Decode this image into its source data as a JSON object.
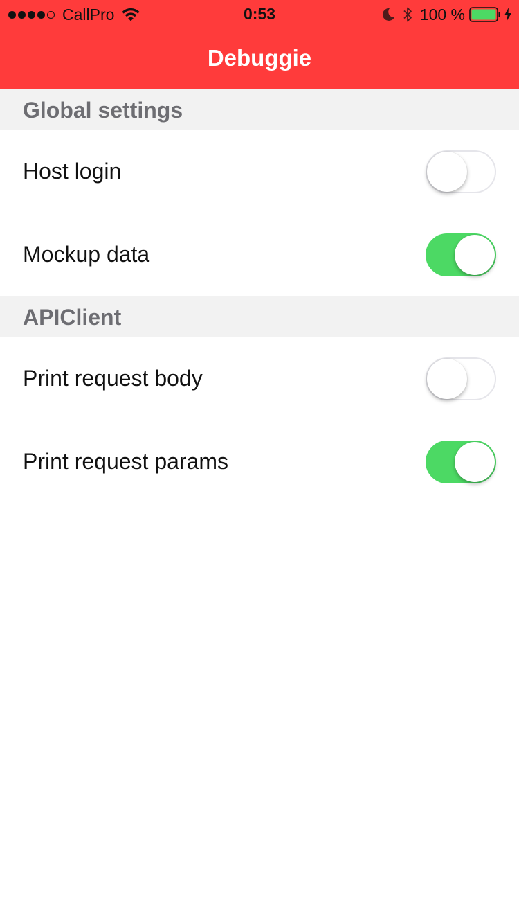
{
  "status_bar": {
    "carrier": "CallPro",
    "time": "0:53",
    "battery_percent": "100 %",
    "signal_bars_filled": 4,
    "signal_bars_total": 5,
    "icons": [
      "wifi-icon",
      "moon-icon",
      "bluetooth-icon",
      "battery-icon",
      "charging-icon"
    ]
  },
  "nav": {
    "title": "Debuggie"
  },
  "colors": {
    "nav_background": "#FF3B3B",
    "switch_on": "#4CD964",
    "section_background": "#F2F2F2",
    "section_text": "#6D6D72"
  },
  "sections": [
    {
      "title": "Global settings",
      "rows": [
        {
          "label": "Host login",
          "on": false
        },
        {
          "label": "Mockup data",
          "on": true
        }
      ]
    },
    {
      "title": "APIClient",
      "rows": [
        {
          "label": "Print request body",
          "on": false
        },
        {
          "label": "Print request params",
          "on": true
        }
      ]
    }
  ]
}
